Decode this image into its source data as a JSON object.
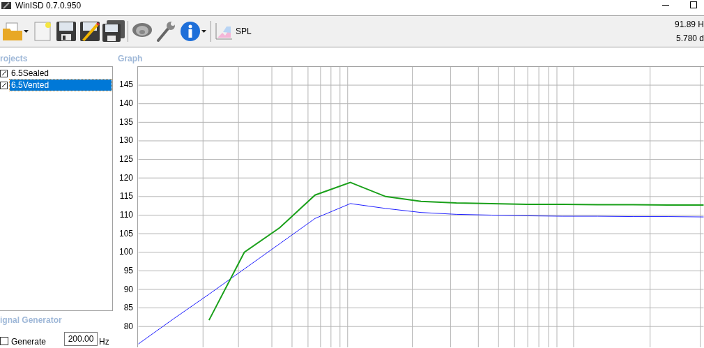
{
  "window": {
    "title": "WinISD 0.7.0.950"
  },
  "toolbar": {
    "spl_label": "SPL",
    "readings": [
      "91.89 H",
      "5.780 d"
    ]
  },
  "projects": {
    "label": "rojects",
    "items": [
      {
        "name": "6.5Sealed",
        "checked": true,
        "selected": false
      },
      {
        "name": "6.5Vented",
        "checked": true,
        "selected": true
      }
    ]
  },
  "graph": {
    "label": "Graph",
    "chart_data": {
      "type": "line",
      "grid": true,
      "ylim": [
        74.4,
        149.9
      ],
      "yticks": [
        80,
        85,
        90,
        95,
        100,
        105,
        110,
        115,
        120,
        125,
        130,
        135,
        140,
        145
      ],
      "series": [
        {
          "color": "#2020ff",
          "values": [
            75.3,
            82.1,
            88.7,
            95.5,
            102.3,
            109.1,
            113.1,
            111.8,
            110.7,
            110.2,
            110.0,
            109.8,
            109.7,
            109.7,
            109.6,
            109.6,
            109.5
          ]
        },
        {
          "color": "#1aa01a",
          "values": [
            null,
            null,
            81.7,
            100.0,
            106.6,
            115.4,
            118.8,
            115.0,
            113.7,
            113.3,
            113.1,
            112.9,
            112.9,
            112.8,
            112.8,
            112.7,
            112.7
          ]
        }
      ]
    }
  },
  "signal_generator": {
    "label": "ignal Generator",
    "generate": {
      "label": "Generate",
      "checked": false
    },
    "frequency": {
      "value": "200.00",
      "unit": "Hz"
    }
  }
}
